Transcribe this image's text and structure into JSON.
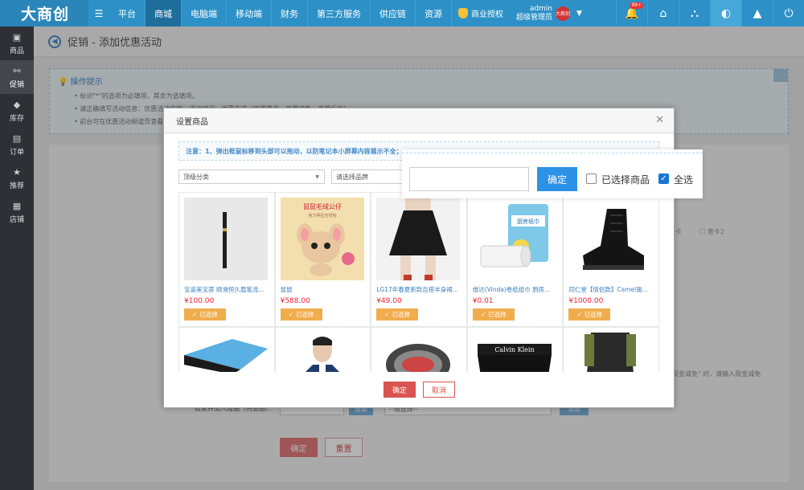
{
  "topbar": {
    "logo": "大商创",
    "nav": [
      "平台",
      "商城",
      "电脑端",
      "移动端",
      "财务",
      "第三方服务",
      "供应链",
      "资源"
    ],
    "auth_label": "商业授权",
    "admin_name": "admin",
    "admin_role": "超级管理员",
    "avatar_text": "大商创",
    "notif_badge": "99+",
    "accent_color": "#2d91c7"
  },
  "sidebar": {
    "items": [
      {
        "label": "商品",
        "icon": "basket-icon"
      },
      {
        "label": "促销",
        "icon": "share-icon"
      },
      {
        "label": "库存",
        "icon": "tag-icon"
      },
      {
        "label": "订单",
        "icon": "clipboard-icon"
      },
      {
        "label": "推荐",
        "icon": "star-icon"
      },
      {
        "label": "店铺",
        "icon": "store-icon"
      }
    ]
  },
  "page": {
    "title": "促销 - 添加优惠活动",
    "tips_title": "操作提示",
    "tips": [
      "标识\"*\"的选项为必填项，其余为选填项。",
      "请正确填写活动信息：优惠活动名称、活动时间，优惠方式（享受赠品、享受减免、享受折扣）",
      "前台可在优惠活动频道页查看"
    ],
    "bg_checks": [
      "普卡",
      "普卡2"
    ],
    "bg_note": "现金减免\" 时，请输入现金减免",
    "search_label": "搜索并加入赠品（特惠品）：",
    "search_btn": "搜索",
    "select_placeholder": "--请选择--",
    "add_btn": "添加",
    "confirm_btn": "确定",
    "reset_btn": "重置"
  },
  "modal": {
    "title": "设置商品",
    "notice": "注意：1、弹出框鼠标移到头部可以拖动，以防笔记本小屏幕内容展示不全；",
    "category_select": "顶级分类",
    "brand_select": "请选择品牌",
    "selected_label": "已选择",
    "products": [
      {
        "name": "宝姿美宝莲 顺滑恒久眉笔流...",
        "price": "¥100.00"
      },
      {
        "name": "鼠鼠",
        "price": "¥588.00"
      },
      {
        "name": "LG17年春夏新款百搭半身裙...",
        "price": "¥49.00"
      },
      {
        "name": "维达(Vinda)卷纸纸巾 厨房...",
        "price": "¥0.01"
      },
      {
        "name": "同仁堂【情侣款】Camel骆...",
        "price": "¥1000.00"
      },
      {
        "name": "",
        "price": ""
      },
      {
        "name": "",
        "price": ""
      },
      {
        "name": "",
        "price": ""
      },
      {
        "name": "",
        "price": ""
      },
      {
        "name": "",
        "price": ""
      }
    ],
    "poster_text": "鼠鼠毛绒公仔",
    "poster_sub": "官方明星吉祥物",
    "tissue_text": "厨房纸巾",
    "underwear_brand": "Calvin Klein",
    "confirm": "确定",
    "cancel": "取消"
  },
  "zoom": {
    "confirm": "确定",
    "selected_only": "已选择商品",
    "select_all": "全选",
    "select_all_checked": true,
    "selected_only_checked": false
  }
}
